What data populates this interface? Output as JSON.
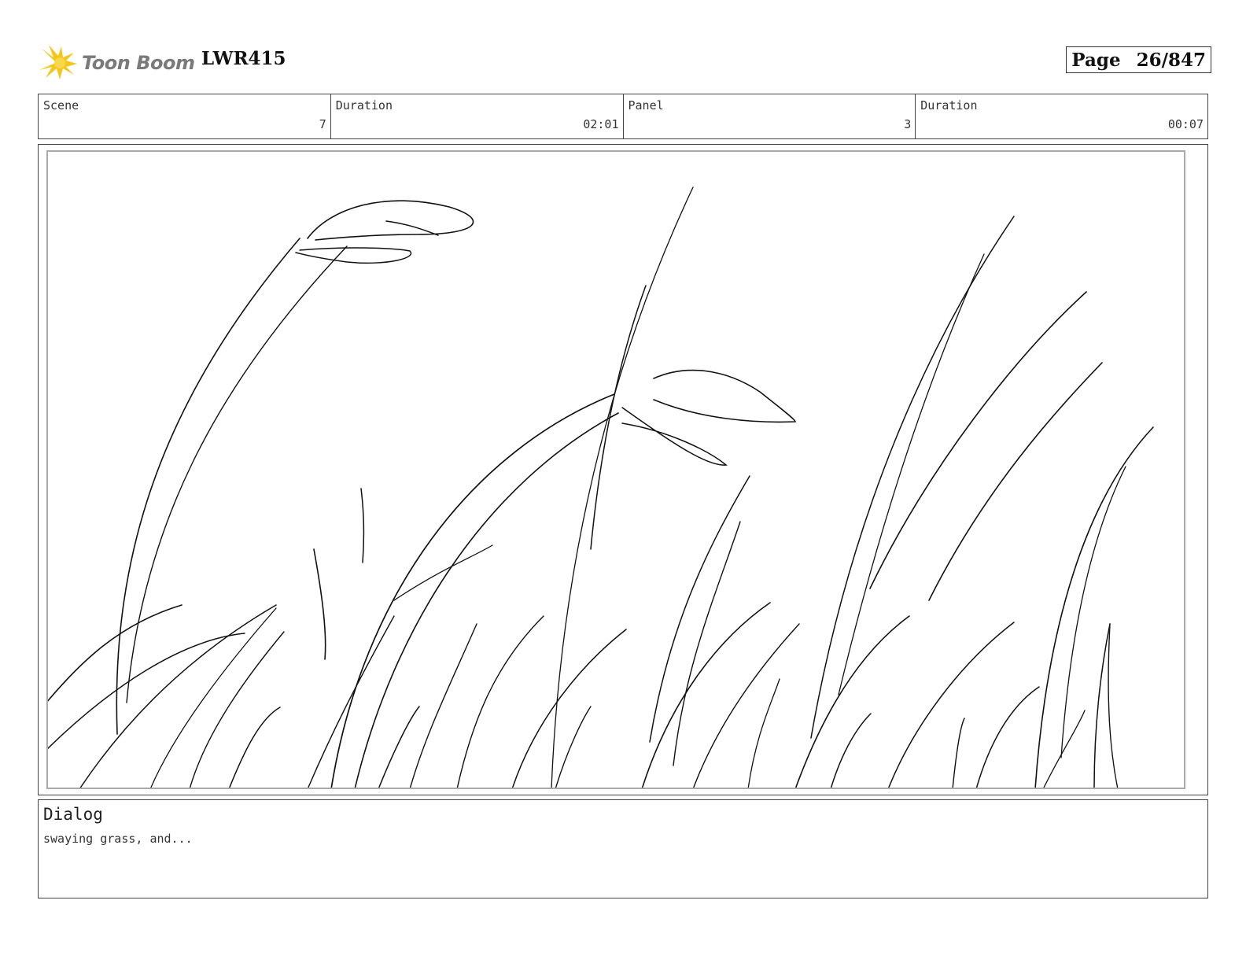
{
  "header": {
    "logo_text": "Toon Boom",
    "project_code": "LWR415",
    "page_label": "Page",
    "page_number": "26/847"
  },
  "info": [
    {
      "label": "Scene",
      "value": "7"
    },
    {
      "label": "Duration",
      "value": "02:01"
    },
    {
      "label": "Panel",
      "value": "3"
    },
    {
      "label": "Duration",
      "value": "00:07"
    }
  ],
  "panel": {
    "drawing_icon": "grass-sketch"
  },
  "dialog": {
    "title": "Dialog",
    "text": "swaying grass, and..."
  },
  "colors": {
    "logo_star": "#f5c518",
    "logo_text": "#7a7a7a",
    "frame_border": "#444444",
    "inner_border": "#aaaaaa"
  }
}
